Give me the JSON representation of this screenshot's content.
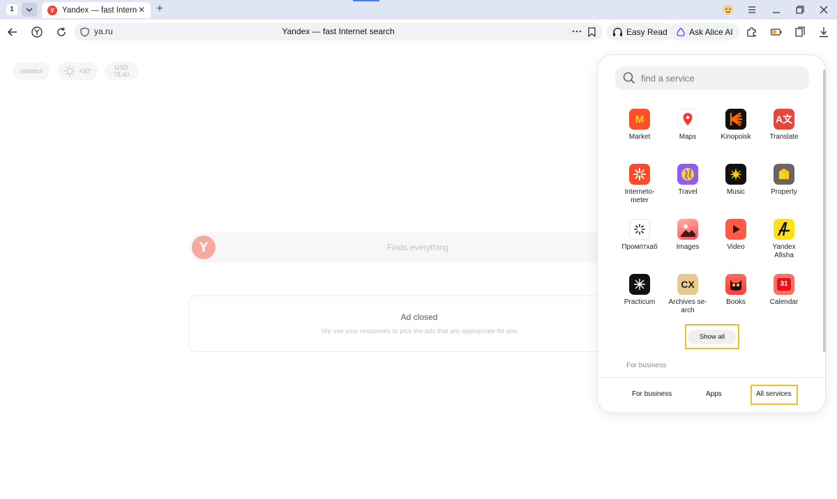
{
  "browser": {
    "tab_count": "1",
    "tab_title": "Yandex — fast Internet search",
    "url": "ya.ru",
    "page_title": "Yandex — fast Internet search",
    "easy_read": "Easy Read",
    "ask_alice": "Ask Alice AI",
    "favicon_letter": "Y"
  },
  "widgets": {
    "city": "Istanbul",
    "weather": "+30°",
    "currency_name": "USD",
    "currency_value": "78,40"
  },
  "search": {
    "logo_letter": "Y",
    "placeholder": "Finds everything"
  },
  "ad": {
    "title": "Ad closed",
    "note": "We use your responses to pick the ads that are appropriate for you"
  },
  "services_panel": {
    "search_placeholder": "find a service",
    "services": [
      {
        "name": "Market",
        "icon": "market-icon"
      },
      {
        "name": "Maps",
        "icon": "maps-icon"
      },
      {
        "name": "Kinopoisk",
        "icon": "kinopoisk-icon"
      },
      {
        "name": "Translate",
        "icon": "translate-icon"
      },
      {
        "name": "Interneto-meter",
        "icon": "internetometer-icon"
      },
      {
        "name": "Travel",
        "icon": "travel-icon"
      },
      {
        "name": "Music",
        "icon": "music-icon"
      },
      {
        "name": "Property",
        "icon": "property-icon"
      },
      {
        "name": "Промптхаб",
        "icon": "prompthub-icon"
      },
      {
        "name": "Images",
        "icon": "images-icon"
      },
      {
        "name": "Video",
        "icon": "video-icon"
      },
      {
        "name": "Yandex Afisha",
        "icon": "afisha-icon"
      },
      {
        "name": "Practicum",
        "icon": "practicum-icon"
      },
      {
        "name": "Archives se-arch",
        "icon": "archives-icon"
      },
      {
        "name": "Books",
        "icon": "books-icon"
      },
      {
        "name": "Calendar",
        "icon": "calendar-icon"
      }
    ],
    "show_all": "Show all",
    "section_label": "For business",
    "bottom_tabs": [
      "For business",
      "Apps",
      "All services"
    ],
    "calendar_day": "31",
    "highlight_color": "#f0c020"
  }
}
